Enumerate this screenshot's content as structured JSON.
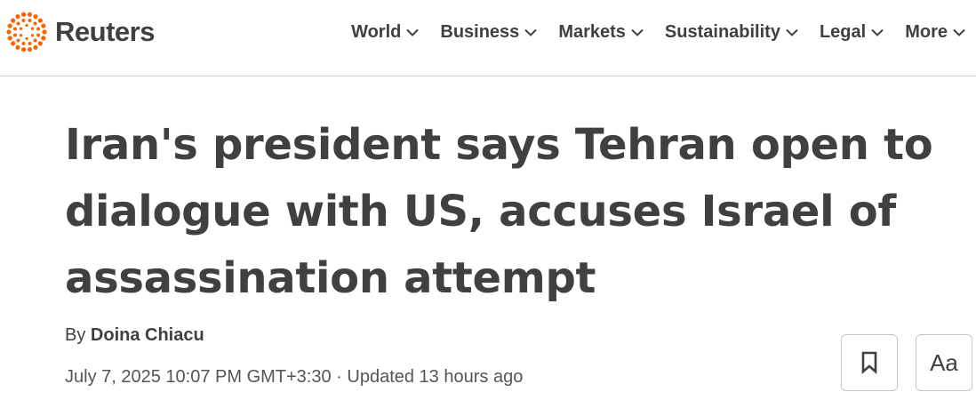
{
  "brand": {
    "name": "Reuters",
    "logo_icon": "reuters-dot-ring-icon",
    "accent": "#fa6400"
  },
  "nav": {
    "items": [
      {
        "label": "World"
      },
      {
        "label": "Business"
      },
      {
        "label": "Markets"
      },
      {
        "label": "Sustainability"
      },
      {
        "label": "Legal"
      },
      {
        "label": "More"
      }
    ]
  },
  "article": {
    "headline": "Iran's president says Tehran open to dialogue with US, accuses Israel of assassination attempt",
    "byline_prefix": "By ",
    "author": "Doina Chiacu",
    "dateline": "July 7, 2025 10:07 PM GMT+3:30 · Updated 13 hours ago"
  },
  "actions": {
    "bookmark_icon": "bookmark-icon",
    "text_size_label": "Aa"
  }
}
